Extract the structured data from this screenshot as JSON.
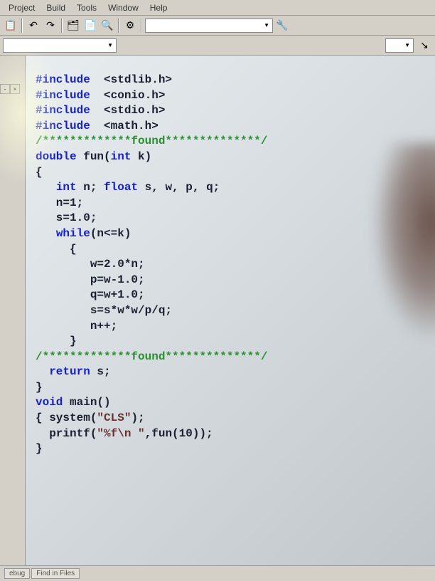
{
  "menu": {
    "items": [
      "Project",
      "Build",
      "Tools",
      "Window",
      "Help"
    ]
  },
  "toolbar": {
    "dropdown1": "",
    "dropdown2": ""
  },
  "status": {
    "tab1": "ebug",
    "tab2": "Find in Files"
  },
  "code": {
    "lines": [
      {
        "parts": [
          {
            "cls": "kw-preproc",
            "t": "#include"
          },
          {
            "cls": "",
            "t": "  <stdlib.h>"
          }
        ]
      },
      {
        "parts": [
          {
            "cls": "kw-preproc",
            "t": "#include"
          },
          {
            "cls": "",
            "t": "  <conio.h>"
          }
        ]
      },
      {
        "parts": [
          {
            "cls": "kw-preproc",
            "t": "#include"
          },
          {
            "cls": "",
            "t": "  <stdio.h>"
          }
        ]
      },
      {
        "parts": [
          {
            "cls": "kw-preproc",
            "t": "#include"
          },
          {
            "cls": "",
            "t": "  <math.h>"
          }
        ]
      },
      {
        "parts": [
          {
            "cls": "comment",
            "t": "/*************found**************/"
          }
        ]
      },
      {
        "parts": [
          {
            "cls": "kw-type",
            "t": "double"
          },
          {
            "cls": "",
            "t": " fun("
          },
          {
            "cls": "kw-type",
            "t": "int"
          },
          {
            "cls": "",
            "t": " k)"
          }
        ]
      },
      {
        "parts": [
          {
            "cls": "",
            "t": "{"
          }
        ]
      },
      {
        "parts": [
          {
            "cls": "",
            "t": "   "
          },
          {
            "cls": "kw-type",
            "t": "int"
          },
          {
            "cls": "",
            "t": " n; "
          },
          {
            "cls": "kw-type",
            "t": "float"
          },
          {
            "cls": "",
            "t": " s, w, p, q;"
          }
        ]
      },
      {
        "parts": [
          {
            "cls": "",
            "t": "   n=1;"
          }
        ]
      },
      {
        "parts": [
          {
            "cls": "",
            "t": "   s=1.0;"
          }
        ]
      },
      {
        "parts": [
          {
            "cls": "",
            "t": "   "
          },
          {
            "cls": "kw-ctrl",
            "t": "while"
          },
          {
            "cls": "",
            "t": "(n<=k)"
          }
        ]
      },
      {
        "parts": [
          {
            "cls": "",
            "t": "     {"
          }
        ]
      },
      {
        "parts": [
          {
            "cls": "",
            "t": "        w=2.0*n;"
          }
        ]
      },
      {
        "parts": [
          {
            "cls": "",
            "t": "        p=w-1.0;"
          }
        ]
      },
      {
        "parts": [
          {
            "cls": "",
            "t": "        q=w+1.0;"
          }
        ]
      },
      {
        "parts": [
          {
            "cls": "",
            "t": "        s=s*w*w/p/q;"
          }
        ]
      },
      {
        "parts": [
          {
            "cls": "",
            "t": "        n++;"
          }
        ]
      },
      {
        "parts": [
          {
            "cls": "",
            "t": "     }"
          }
        ]
      },
      {
        "parts": [
          {
            "cls": "comment",
            "t": "/*************found**************/"
          }
        ]
      },
      {
        "parts": [
          {
            "cls": "",
            "t": "  "
          },
          {
            "cls": "kw-ctrl",
            "t": "return"
          },
          {
            "cls": "",
            "t": " s;"
          }
        ]
      },
      {
        "parts": [
          {
            "cls": "",
            "t": "}"
          }
        ]
      },
      {
        "parts": [
          {
            "cls": "kw-type",
            "t": "void"
          },
          {
            "cls": "",
            "t": " main()"
          }
        ]
      },
      {
        "parts": [
          {
            "cls": "",
            "t": "{ system("
          },
          {
            "cls": "string",
            "t": "\"CLS\""
          },
          {
            "cls": "",
            "t": ");"
          }
        ]
      },
      {
        "parts": [
          {
            "cls": "",
            "t": "  printf("
          },
          {
            "cls": "string",
            "t": "\"%f\\n \""
          },
          {
            "cls": "",
            "t": ",fun(10));"
          }
        ]
      },
      {
        "parts": [
          {
            "cls": "",
            "t": "}"
          }
        ]
      }
    ]
  }
}
